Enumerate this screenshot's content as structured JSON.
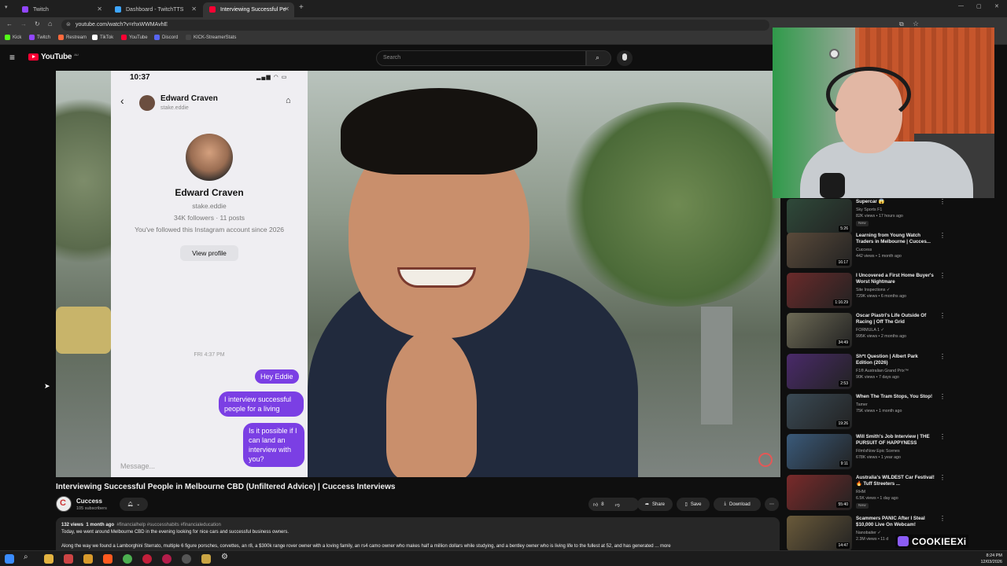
{
  "browser": {
    "tabs": [
      {
        "label": "Twitch",
        "color": "#9146ff"
      },
      {
        "label": "Dashboard - TwitchTTS",
        "color": "#3ea6ff"
      },
      {
        "label": "Interviewing Successful Pe",
        "color": "#ff0033"
      }
    ],
    "url": "youtube.com/watch?v=rhxWWMAvhE",
    "bookmarks": [
      "Kick",
      "Twitch",
      "Restream",
      "TikTok",
      "YouTube",
      "Discord",
      "KICK-StreamerStats"
    ]
  },
  "youtube": {
    "logo_text": "YouTube",
    "logo_superscript": "AU",
    "search_placeholder": "Search"
  },
  "phone": {
    "time": "10:37",
    "contact_name": "Edward Craven",
    "contact_handle": "stake.eddie",
    "profile_name": "Edward Craven",
    "profile_handle": "stake.eddie",
    "profile_stats": "34K followers · 11 posts",
    "followed_note": "You've followed this Instagram account since 2026",
    "view_profile": "View profile",
    "date_stamp": "FRI 4:37 PM",
    "messages": [
      "Hey Eddie",
      "I interview successful people for a living",
      "Is it possible if I can land an interview with you?"
    ],
    "message_placeholder": "Message..."
  },
  "video": {
    "title": "Interviewing Successful People in Melbourne CBD (Unfiltered Advice) | Cuccess Interviews",
    "channel": "Cuccess",
    "subscribers": "105 subscribers",
    "likes": "8",
    "share": "Share",
    "save": "Save",
    "download": "Download",
    "views": "132 views",
    "age": "1 month ago",
    "hashtags": "#financialhelp #successhabits #financialeducation",
    "desc_line1": "Today, we went around Melbourne CBD in the evening looking for nice cars and successful business owners.",
    "desc_line2": "Along the way we found a Lamborghini Sterrato, multiple 6 figure porsches, corvettes, an r8, a $300k range rover owner with a loving family, an rs4 camo owner who makes half a million dollars while studying, and a bentley owner who is living life to the fullest at 52, and has generated ... more"
  },
  "sidebar": [
    {
      "title": "Supercar 😱",
      "channel": "Sky Sports F1",
      "meta": "82K views • 17 hours ago",
      "duration": "5:26",
      "badge": "New",
      "thumb": "#2f4a3a"
    },
    {
      "title": "Learning from Young Watch Traders in Melbourne | Cucces...",
      "channel": "Cuccess",
      "meta": "442 views • 1 month ago",
      "duration": "16:17",
      "badge": "",
      "thumb": "#5a4a3a"
    },
    {
      "title": "I Uncovered a First Home Buyer's Worst Nightmare",
      "channel": "Site Inspections ✓",
      "meta": "729K views • 6 months ago",
      "duration": "1:16:29",
      "badge": "",
      "thumb": "#6a2a2a"
    },
    {
      "title": "Oscar Piastri's Life Outside Of Racing | Off The Grid",
      "channel": "FORMULA 1 ✓",
      "meta": "995K views • 2 months ago",
      "duration": "34:49",
      "badge": "",
      "thumb": "#6d6a55"
    },
    {
      "title": "Sh*t Question | Albert Park Edition (2026)",
      "channel": "F1® Australian Grand Prix™",
      "meta": "90K views • 7 days ago",
      "duration": "2:53",
      "badge": "",
      "thumb": "#4a2a6a"
    },
    {
      "title": "When The Tram Stops, You Stop!",
      "channel": "Tamer",
      "meta": "75K views • 1 month ago",
      "duration": "19:26",
      "badge": "",
      "thumb": "#3a4a55"
    },
    {
      "title": "Will Smith's Job Interview | THE PURSUIT OF HAPPYNESS",
      "channel": "FilmIsNow Epic Scenes",
      "meta": "678K views • 1 year ago",
      "duration": "9:11",
      "badge": "",
      "thumb": "#3a5a7a"
    },
    {
      "title": "Australia's WILDEST Car Festival! 🔥 Tuff Streeters ...",
      "channel": "RHM",
      "meta": "6.5K views • 1 day ago",
      "duration": "55:40",
      "badge": "New",
      "thumb": "#7a2a2a"
    },
    {
      "title": "Scammers PANIC After I Steal $10,000 Live On Webcam!",
      "channel": "Nanobaiter ✓",
      "meta": "2.3M views • 11 d",
      "duration": "14:47",
      "badge": "",
      "thumb": "#6a5a3a"
    }
  ],
  "overlay": {
    "streamer_name": "COOKIEEXi"
  },
  "taskbar": {
    "time": "8:24 PM",
    "date": "12/03/2026"
  }
}
